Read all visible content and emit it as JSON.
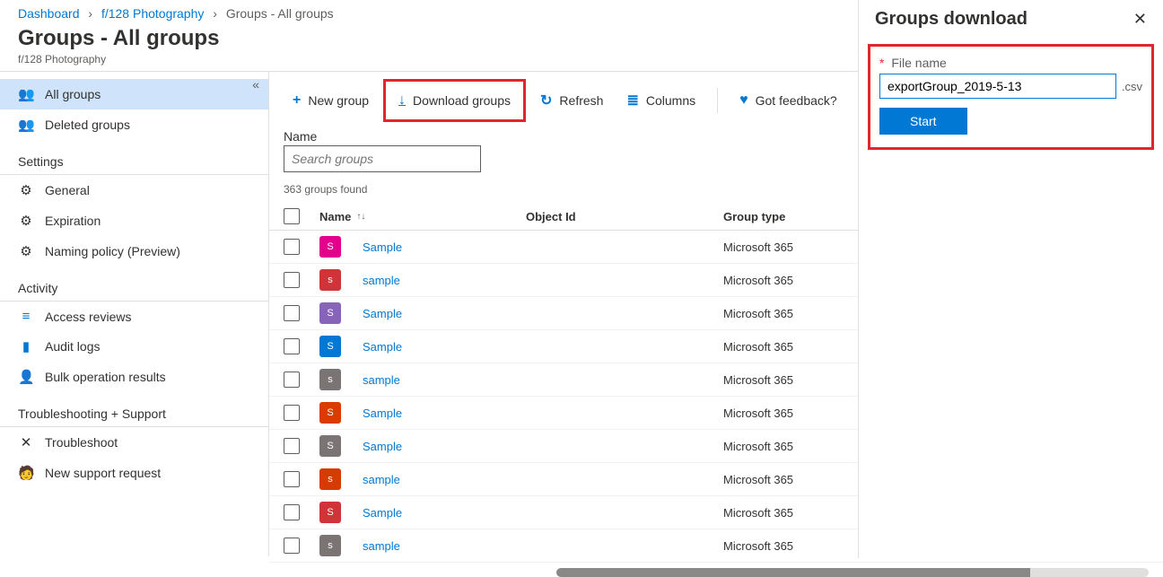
{
  "breadcrumbs": {
    "items": [
      "Dashboard",
      "f/128 Photography",
      "Groups - All groups"
    ]
  },
  "header": {
    "title": "Groups - All groups",
    "subtitle": "f/128 Photography"
  },
  "sidebar": {
    "groups": {
      "all": "All groups",
      "deleted": "Deleted groups"
    },
    "settings_label": "Settings",
    "settings": {
      "general": "General",
      "expiration": "Expiration",
      "naming": "Naming policy (Preview)"
    },
    "activity_label": "Activity",
    "activity": {
      "access": "Access reviews",
      "audit": "Audit logs",
      "bulk": "Bulk operation results"
    },
    "trouble_label": "Troubleshooting + Support",
    "trouble": {
      "troubleshoot": "Troubleshoot",
      "support": "New support request"
    }
  },
  "toolbar": {
    "new_group": "New group",
    "download": "Download groups",
    "refresh": "Refresh",
    "columns": "Columns",
    "feedback": "Got feedback?"
  },
  "search": {
    "label": "Name",
    "placeholder": "Search groups"
  },
  "found_text": "363 groups found",
  "columns": {
    "name": "Name",
    "object_id": "Object Id",
    "group_type": "Group type"
  },
  "rows": [
    {
      "letter": "S",
      "color": "#e3008c",
      "name": "Sample",
      "type": "Microsoft 365"
    },
    {
      "letter": "s",
      "color": "#d13438",
      "name": "sample",
      "type": "Microsoft 365"
    },
    {
      "letter": "S",
      "color": "#8764b8",
      "name": "Sample",
      "type": "Microsoft 365"
    },
    {
      "letter": "S",
      "color": "#0078d4",
      "name": "Sample",
      "type": "Microsoft 365"
    },
    {
      "letter": "s",
      "color": "#7a7574",
      "name": "sample",
      "type": "Microsoft 365"
    },
    {
      "letter": "S",
      "color": "#da3b01",
      "name": "Sample",
      "type": "Microsoft 365"
    },
    {
      "letter": "S",
      "color": "#7a7574",
      "name": "Sample",
      "type": "Microsoft 365"
    },
    {
      "letter": "s",
      "color": "#d83b01",
      "name": "sample",
      "type": "Microsoft 365"
    },
    {
      "letter": "S",
      "color": "#d13438",
      "name": "Sample",
      "type": "Microsoft 365"
    },
    {
      "letter": "s",
      "color": "#7a7574",
      "name": "sample",
      "type": "Microsoft 365"
    }
  ],
  "panel": {
    "title": "Groups download",
    "file_label": "File name",
    "file_value": "exportGroup_2019-5-13",
    "ext": ".csv",
    "start": "Start"
  },
  "icons": {
    "group": "👥",
    "gear": "⚙",
    "list": "≡",
    "book": "▮",
    "people": "👤",
    "wrench": "✕",
    "support": "🧑",
    "plus": "+",
    "download": "↓",
    "refresh": "↻",
    "columns": "≣",
    "heart": "♥",
    "close": "✕",
    "chev": "›",
    "collapse": "«",
    "sort": "↑↓"
  },
  "colors": {
    "accent": "#0078d4",
    "highlight": "#e3262d"
  }
}
